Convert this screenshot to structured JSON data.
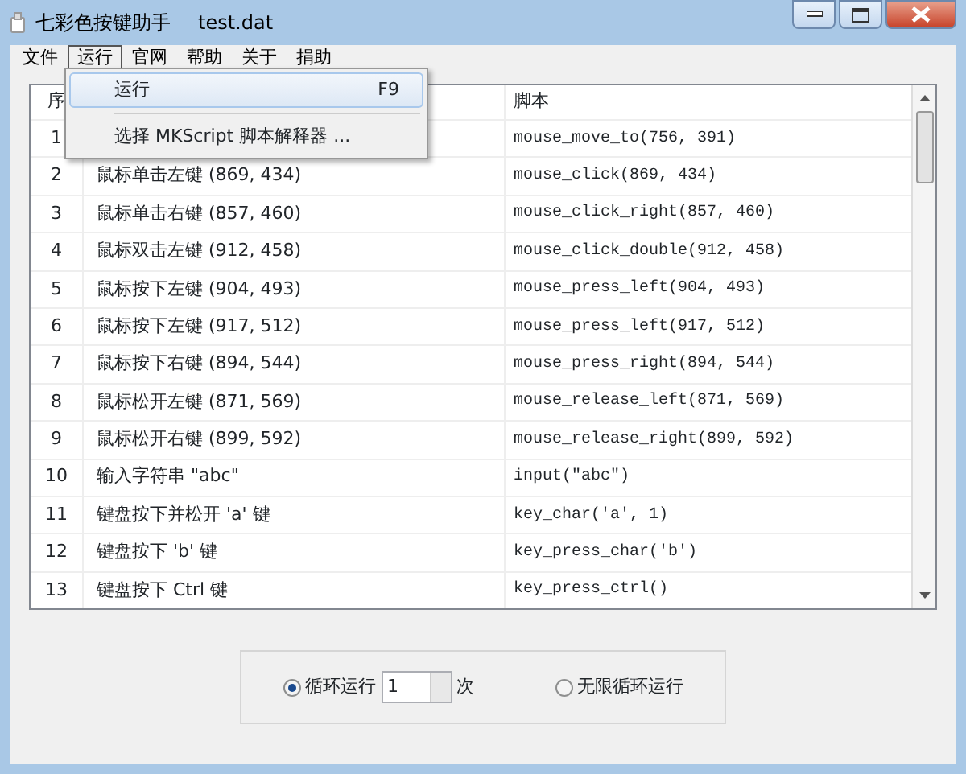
{
  "window": {
    "title": "七彩色按键助手",
    "filename": "test.dat"
  },
  "menu": [
    {
      "label": "文件",
      "selected": false
    },
    {
      "label": "运行",
      "selected": true
    },
    {
      "label": "官网",
      "selected": false
    },
    {
      "label": "帮助",
      "selected": false
    },
    {
      "label": "关于",
      "selected": false
    },
    {
      "label": "捐助",
      "selected": false
    }
  ],
  "dropdown": [
    {
      "label": "运行",
      "shortcut": "F9",
      "selected": true
    },
    {
      "label": "选择 MKScript 脚本解释器 ...",
      "selected": false
    }
  ],
  "table": {
    "columns": [
      "序",
      "脚本"
    ],
    "rows": [
      {
        "index": "1",
        "script": "mouse_move_to(756, 391)"
      },
      {
        "index": "2",
        "description": "鼠标单击左键 (869, 434)",
        "script": "mouse_click(869, 434)"
      },
      {
        "index": "3",
        "description": "鼠标单击右键 (857, 460)",
        "script": "mouse_click_right(857, 460)"
      },
      {
        "index": "4",
        "description": "鼠标双击左键 (912, 458)",
        "script": "mouse_click_double(912, 458)"
      },
      {
        "index": "5",
        "description": "鼠标按下左键 (904, 493)",
        "script": "mouse_press_left(904, 493)"
      },
      {
        "index": "6",
        "description": "鼠标按下左键 (917, 512)",
        "script": "mouse_press_left(917, 512)"
      },
      {
        "index": "7",
        "description": "鼠标按下右键 (894, 544)",
        "script": "mouse_press_right(894, 544)"
      },
      {
        "index": "8",
        "description": "鼠标松开左键 (871, 569)",
        "script": "mouse_release_left(871, 569)"
      },
      {
        "index": "9",
        "description": "鼠标松开右键 (899, 592)",
        "script": "mouse_release_right(899, 592)"
      },
      {
        "index": "10",
        "description": "输入字符串 \"abc\"",
        "script": "input(\"abc\")"
      },
      {
        "index": "11",
        "description": "键盘按下并松开 'a' 键",
        "script": "key_char('a', 1)"
      },
      {
        "index": "12",
        "description": "键盘按下 'b' 键",
        "script": "key_press_char('b')"
      },
      {
        "index": "13",
        "description": "键盘按下 Ctrl 键",
        "script": "key_press_ctrl()"
      }
    ]
  },
  "loop_options": [
    {
      "label": "循环运行",
      "selected": true,
      "count": "1",
      "unit": "次"
    },
    {
      "label": "无限循环运行",
      "selected": false
    }
  ]
}
